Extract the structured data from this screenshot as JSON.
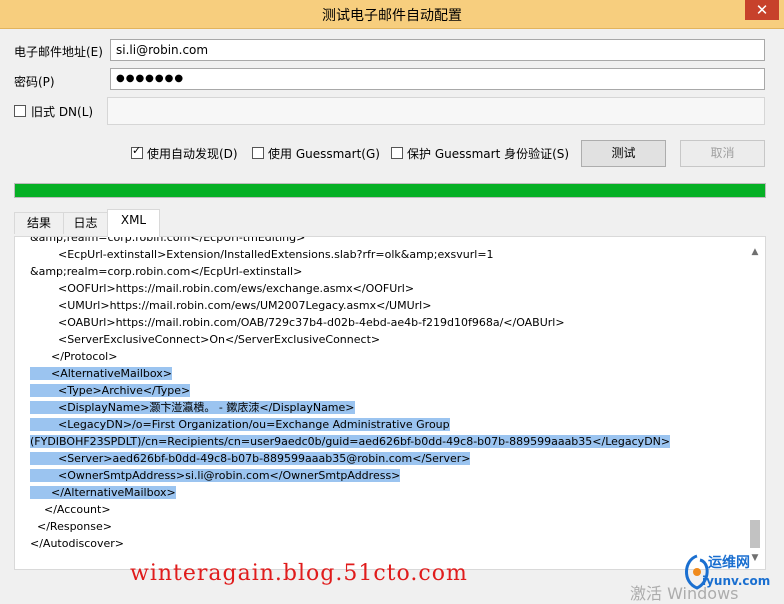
{
  "window": {
    "title": "测试电子邮件自动配置",
    "close_glyph": "✕"
  },
  "form": {
    "email_label": "电子邮件地址(E)",
    "email_value": "si.li@robin.com",
    "password_label": "密码(P)",
    "password_value": "●●●●●●●",
    "legacy_dn_label": "旧式 DN(L)",
    "legacy_dn_value": ""
  },
  "options": {
    "autodiscover_label": "使用自动发现(D)",
    "autodiscover_checked": true,
    "guessmart_label": "使用 Guessmart(G)",
    "guessmart_checked": false,
    "secure_label": "保护 Guessmart 身份验证(S)",
    "secure_checked": false
  },
  "buttons": {
    "test": "测试",
    "cancel": "取消"
  },
  "progress": {
    "percent": 100,
    "color": "#06b025"
  },
  "tabs": [
    {
      "label": "结果",
      "active": false
    },
    {
      "label": "日志",
      "active": false
    },
    {
      "label": "XML",
      "active": true
    }
  ],
  "xml_lines": [
    {
      "text": "&amp;realm=corp.robin.com</EcpUrl-tmEditing>",
      "selected": false
    },
    {
      "text": "        <EcpUrl-extinstall>Extension/InstalledExtensions.slab?rfr=olk&amp;exsvurl=1",
      "selected": false
    },
    {
      "text": "&amp;realm=corp.robin.com</EcpUrl-extinstall>",
      "selected": false
    },
    {
      "text": "        <OOFUrl>https://mail.robin.com/ews/exchange.asmx</OOFUrl>",
      "selected": false
    },
    {
      "text": "        <UMUrl>https://mail.robin.com/ews/UM2007Legacy.asmx</UMUrl>",
      "selected": false
    },
    {
      "text": "        <OABUrl>https://mail.robin.com/OAB/729c37b4-d02b-4ebd-ae4b-f219d10f968a/</OABUrl>",
      "selected": false
    },
    {
      "text": "        <ServerExclusiveConnect>On</ServerExclusiveConnect>",
      "selected": false
    },
    {
      "text": "      </Protocol>",
      "selected": false
    },
    {
      "text": "      <AlternativeMailbox>",
      "selected": true
    },
    {
      "text": "        <Type>Archive</Type>",
      "selected": true
    },
    {
      "text": "        <DisplayName>灏卞湴瀛樻。 - 鏉庡洓</DisplayName>",
      "selected": true
    },
    {
      "text": "        <LegacyDN>/o=First Organization/ou=Exchange Administrative Group",
      "selected": true
    },
    {
      "text": "(FYDIBOHF23SPDLT)/cn=Recipients/cn=user9aedc0b/guid=aed626bf-b0dd-49c8-b07b-889599aaab35</LegacyDN>",
      "selected": true
    },
    {
      "text": "        <Server>aed626bf-b0dd-49c8-b07b-889599aaab35@robin.com</Server>",
      "selected": true
    },
    {
      "text": "        <OwnerSmtpAddress>si.li@robin.com</OwnerSmtpAddress>",
      "selected": true
    },
    {
      "text": "      </AlternativeMailbox>",
      "selected": true
    },
    {
      "text": "    </Account>",
      "selected": false
    },
    {
      "text": "  </Response>",
      "selected": false
    },
    {
      "text": "</Autodiscover>",
      "selected": false
    }
  ],
  "overlays": {
    "blog_watermark": "winteragain.blog.51cto.com",
    "windows_watermark": "激活 Windows",
    "logo_line1": "运维网",
    "logo_line2": "iyunv.com"
  }
}
